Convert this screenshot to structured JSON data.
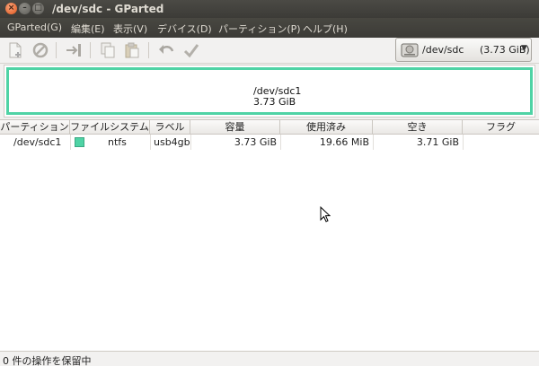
{
  "window": {
    "title": "/dev/sdc - GParted"
  },
  "window_buttons": {
    "close": "×",
    "minimize": "–",
    "maximize": "□"
  },
  "menubar": {
    "items": [
      "GParted(G)",
      "編集(E)",
      "表示(V)",
      "デバイス(D)",
      "パーティション(P)",
      "ヘルプ(H)"
    ]
  },
  "toolbar": {
    "icons": [
      "new-icon",
      "delete-icon",
      "resize-move-icon",
      "copy-icon",
      "paste-icon",
      "undo-icon",
      "apply-icon"
    ]
  },
  "device_selector": {
    "name": "/dev/sdc",
    "size": "(3.73 GiB)"
  },
  "partition_map": {
    "name": "/dev/sdc1",
    "size": "3.73 GiB",
    "color": "#4fd3a5"
  },
  "table": {
    "columns": [
      "パーティション",
      "ファイルシステム",
      "ラベル",
      "容量",
      "使用済み",
      "空き",
      "フラグ"
    ],
    "rows": [
      {
        "partition": "/dev/sdc1",
        "filesystem": "ntfs",
        "fs_color": "#4fd3a5",
        "label": "usb4gb",
        "size": "3.73 GiB",
        "used": "19.66 MiB",
        "unused": "3.71 GiB",
        "flags": ""
      }
    ]
  },
  "statusbar": {
    "text": "0 件の操作を保留中"
  }
}
